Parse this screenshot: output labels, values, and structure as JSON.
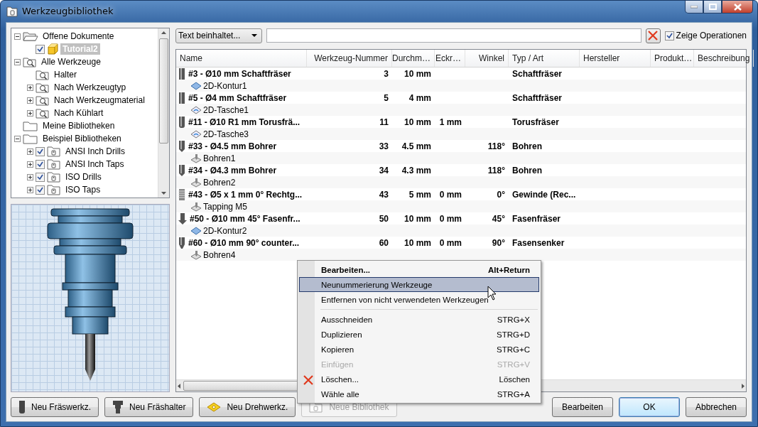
{
  "window": {
    "title": "Werkzeugbibliothek"
  },
  "tree": [
    {
      "label": "Offene Dokumente",
      "kind": "open-folder",
      "expanded": true,
      "selected": false,
      "children": [
        {
          "label": "Tutorial2",
          "kind": "document",
          "checked": true,
          "selected": true
        }
      ]
    },
    {
      "label": "Alle Werkzeuge",
      "kind": "search",
      "expanded": true,
      "selected": false,
      "children": [
        {
          "label": "Halter",
          "kind": "search",
          "selected": false
        },
        {
          "label": "Nach Werkzeugtyp",
          "kind": "search",
          "expanded": false,
          "selected": false
        },
        {
          "label": "Nach Werkzeugmaterial",
          "kind": "search",
          "expanded": false,
          "selected": false
        },
        {
          "label": "Nach Kühlart",
          "kind": "search",
          "expanded": false,
          "selected": false
        }
      ]
    },
    {
      "label": "Meine Bibliotheken",
      "kind": "folder",
      "selected": false
    },
    {
      "label": "Beispiel Bibliotheken",
      "kind": "folder",
      "expanded": true,
      "selected": false,
      "children": [
        {
          "label": "ANSI Inch Drills",
          "kind": "library",
          "expanded": false,
          "checked": true,
          "selected": false
        },
        {
          "label": "ANSI Inch Taps",
          "kind": "library",
          "expanded": false,
          "checked": true,
          "selected": false
        },
        {
          "label": "ISO Drills",
          "kind": "library",
          "expanded": false,
          "checked": true,
          "selected": false
        },
        {
          "label": "ISO Taps",
          "kind": "library",
          "expanded": false,
          "checked": true,
          "selected": false
        }
      ]
    }
  ],
  "filter": {
    "mode": "Text beinhaltet...",
    "show_operations": {
      "label": "Zeige Operationen",
      "checked": true
    }
  },
  "table": {
    "columns": [
      "Name",
      "Werkzeug-Nummer",
      "Durchm…",
      "Eckr…",
      "Winkel",
      "Typ / Art",
      "Hersteller",
      "Produkt…",
      "Beschreibung"
    ],
    "rows": [
      {
        "kind": "flat",
        "name": "#3 - Ø10 mm Schaftfräser",
        "number": "3",
        "diameter": "10 mm",
        "corner": "",
        "angle": "",
        "type": "Schaftfräser",
        "operation": {
          "name": "2D-Kontur1",
          "kind": "contour"
        }
      },
      {
        "kind": "flat",
        "name": "#5 - Ø4 mm Schaftfräser",
        "number": "5",
        "diameter": "4 mm",
        "corner": "",
        "angle": "",
        "type": "Schaftfräser",
        "operation": {
          "name": "2D-Tasche1",
          "kind": "pocket"
        }
      },
      {
        "kind": "bull",
        "name": "#11 - Ø10 R1 mm Torusfrä...",
        "number": "11",
        "diameter": "10 mm",
        "corner": "1 mm",
        "angle": "",
        "type": "Torusfräser",
        "operation": {
          "name": "2D-Tasche3",
          "kind": "pocket"
        }
      },
      {
        "kind": "drill",
        "name": "#33 - Ø4.5 mm Bohrer",
        "number": "33",
        "diameter": "4.5 mm",
        "corner": "",
        "angle": "118°",
        "type": "Bohren",
        "operation": {
          "name": "Bohren1",
          "kind": "drill"
        }
      },
      {
        "kind": "drill",
        "name": "#34 - Ø4.3 mm Bohrer",
        "number": "34",
        "diameter": "4.3 mm",
        "corner": "",
        "angle": "118°",
        "type": "Bohren",
        "operation": {
          "name": "Bohren2",
          "kind": "drill"
        }
      },
      {
        "kind": "tap",
        "name": "#43 - Ø5 x 1 mm 0° Rechtg...",
        "number": "43",
        "diameter": "5 mm",
        "corner": "0 mm",
        "angle": "0°",
        "type": "Gewinde (Rec...",
        "operation": {
          "name": "Tapping M5",
          "kind": "drill"
        }
      },
      {
        "kind": "chamfer",
        "name": "#50 - Ø10 mm 45° Fasenfr...",
        "number": "50",
        "diameter": "10 mm",
        "corner": "0 mm",
        "angle": "45°",
        "type": "Fasenfräser",
        "operation": {
          "name": "2D-Kontur2",
          "kind": "contour"
        }
      },
      {
        "kind": "countersink",
        "name": "#60 - Ø10 mm 90° counter...",
        "number": "60",
        "diameter": "10 mm",
        "corner": "0 mm",
        "angle": "90°",
        "type": "Fasensenker",
        "operation": {
          "name": "Bohren4",
          "kind": "drill"
        }
      }
    ]
  },
  "buttons_left": [
    {
      "label": "Neu Fräswerkz.",
      "kind": "mill",
      "disabled": false
    },
    {
      "label": "Neu Fräshalter",
      "kind": "holder",
      "disabled": false
    },
    {
      "label": "Neu Drehwerkz.",
      "kind": "turn",
      "disabled": false
    },
    {
      "label": "Neue Bibliothek",
      "kind": "library",
      "disabled": true
    }
  ],
  "buttons_right": [
    {
      "label": "Bearbeiten",
      "default": false
    },
    {
      "label": "OK",
      "default": true
    },
    {
      "label": "Abbrechen",
      "default": false
    }
  ],
  "context_menu": [
    {
      "kind": "item",
      "label": "Bearbeiten...",
      "shortcut": "Alt+Return",
      "bold": true,
      "selected": false,
      "disabled": false
    },
    {
      "kind": "item",
      "label": "Neunummerierung Werkzeuge",
      "bold": false,
      "selected": true,
      "disabled": false
    },
    {
      "kind": "item",
      "label": "Entfernen von nicht verwendeten Werkzeugen",
      "bold": false,
      "selected": false,
      "disabled": false
    },
    {
      "kind": "separator"
    },
    {
      "kind": "item",
      "label": "Ausschneiden",
      "shortcut": "STRG+X",
      "bold": false,
      "selected": false,
      "disabled": false
    },
    {
      "kind": "item",
      "label": "Duplizieren",
      "shortcut": "STRG+D",
      "bold": false,
      "selected": false,
      "disabled": false
    },
    {
      "kind": "item",
      "label": "Kopieren",
      "shortcut": "STRG+C",
      "bold": false,
      "selected": false,
      "disabled": false
    },
    {
      "kind": "item",
      "label": "Einfügen",
      "shortcut": "STRG+V",
      "bold": false,
      "selected": false,
      "disabled": true
    },
    {
      "kind": "delete",
      "label": "Löschen...",
      "shortcut": "Löschen",
      "bold": false,
      "selected": false,
      "disabled": false
    },
    {
      "kind": "item",
      "label": "Wähle alle",
      "shortcut": "STRG+A",
      "bold": false,
      "selected": false,
      "disabled": false
    }
  ]
}
